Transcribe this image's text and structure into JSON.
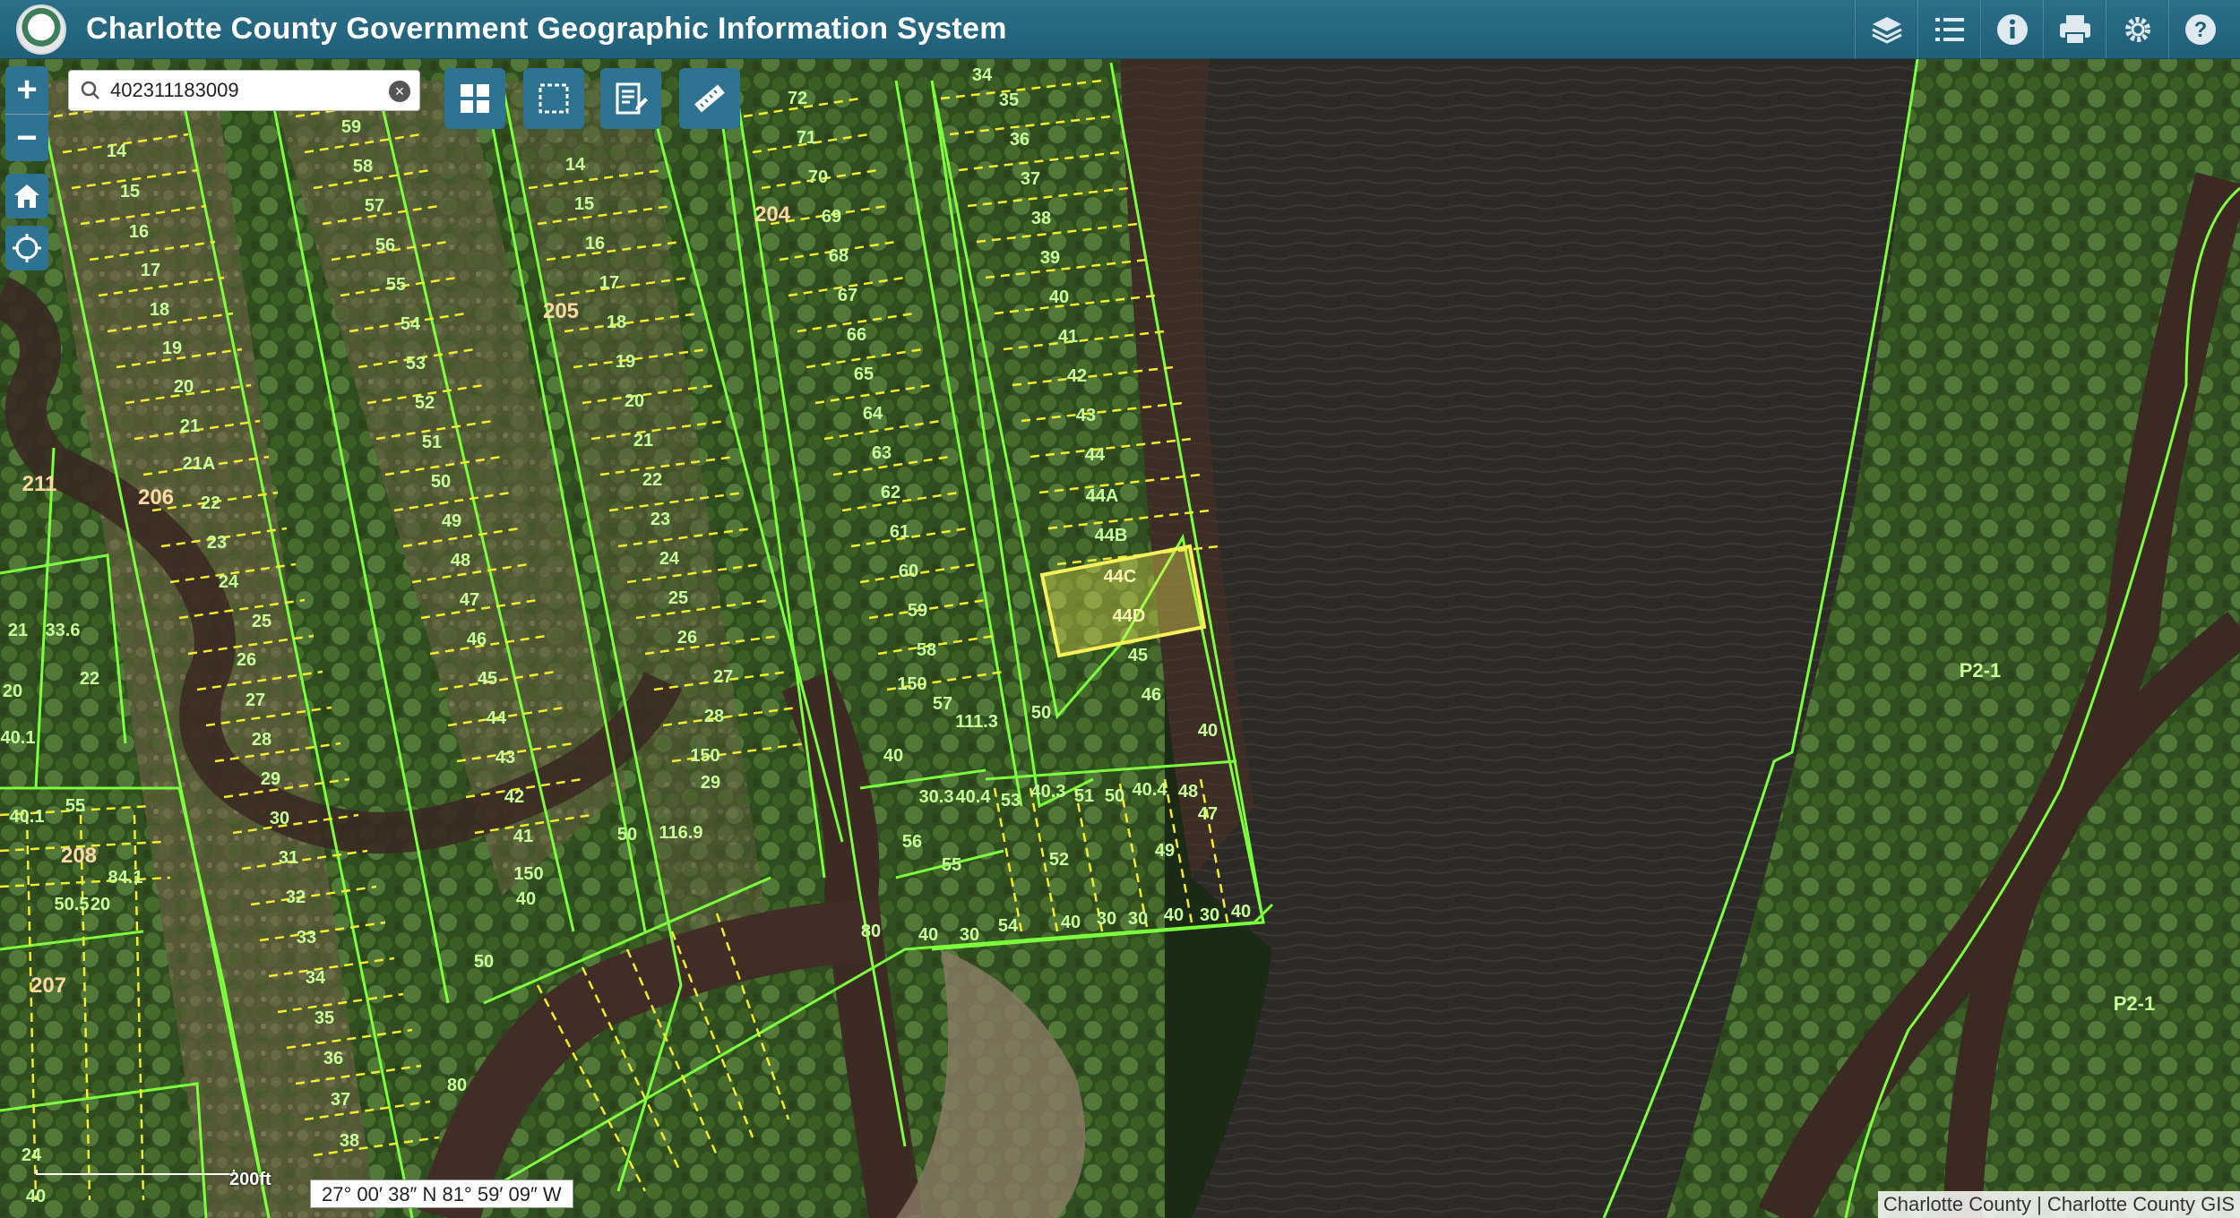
{
  "header": {
    "title": "Charlotte County Government Geographic Information System",
    "tools": [
      {
        "name": "layers-icon"
      },
      {
        "name": "legend-list-icon"
      },
      {
        "name": "info-icon"
      },
      {
        "name": "print-icon"
      },
      {
        "name": "tools-gear-icon"
      },
      {
        "name": "help-icon"
      }
    ]
  },
  "search": {
    "value": "402311183009"
  },
  "zoom": {
    "in_label": "+",
    "out_label": "−"
  },
  "scale": {
    "label": "200ft"
  },
  "coords": {
    "text": "27° 00′ 38″ N 81° 59′ 09″ W"
  },
  "attribution": {
    "text": "Charlotte County | Charlotte County GIS"
  },
  "map": {
    "selected_parcel": [
      "44C",
      "44D"
    ],
    "block_labels": [
      "204",
      "205",
      "206",
      "211",
      "208",
      "207"
    ],
    "district_labels": [
      "P2-1",
      "P2-1"
    ],
    "col1_lots": [
      "14",
      "15",
      "16",
      "17",
      "18",
      "19",
      "20",
      "21",
      "21A",
      "22",
      "23",
      "24",
      "25",
      "26",
      "27",
      "28",
      "29",
      "30",
      "31",
      "32",
      "33",
      "34",
      "35",
      "36",
      "37",
      "38"
    ],
    "col2_lots": [
      "59",
      "58",
      "57",
      "56",
      "55",
      "54",
      "53",
      "52",
      "51",
      "50",
      "49",
      "48",
      "47",
      "46",
      "45",
      "44",
      "43",
      "42",
      "41",
      "150",
      "40"
    ],
    "col3_lots": [
      "14",
      "15",
      "16",
      "17",
      "18",
      "19",
      "20",
      "21",
      "22",
      "23",
      "24",
      "25",
      "26",
      "27",
      "28",
      "150",
      "29"
    ],
    "col4_lots": [
      "72",
      "71",
      "70",
      "69",
      "68",
      "67",
      "66",
      "65",
      "64",
      "63",
      "62",
      "61",
      "60",
      "59",
      "58",
      "57"
    ],
    "col5_lots": [
      "34",
      "35",
      "36",
      "37",
      "38",
      "39",
      "40",
      "41",
      "42",
      "43",
      "44",
      "44A",
      "44B",
      "45",
      "46"
    ],
    "bottom_lots": [
      "53",
      "51",
      "50",
      "48",
      "47",
      "52",
      "49",
      "55",
      "56"
    ],
    "dim_labels": [
      "40",
      "50",
      "30",
      "111.3",
      "150",
      "60",
      "80",
      "116.9",
      "40.4",
      "30.3",
      "40.1",
      "84.1",
      "55",
      "40.5",
      "20"
    ],
    "colors": {
      "parcel_line": "#7cff3c",
      "lot_dash": "#f4ec2e",
      "selection": "#f8f25a",
      "label": "#c9ff9a",
      "block_label": "#ffd9a3",
      "header_bg": "#1f5f78",
      "button_bg": "#2e7391"
    }
  }
}
